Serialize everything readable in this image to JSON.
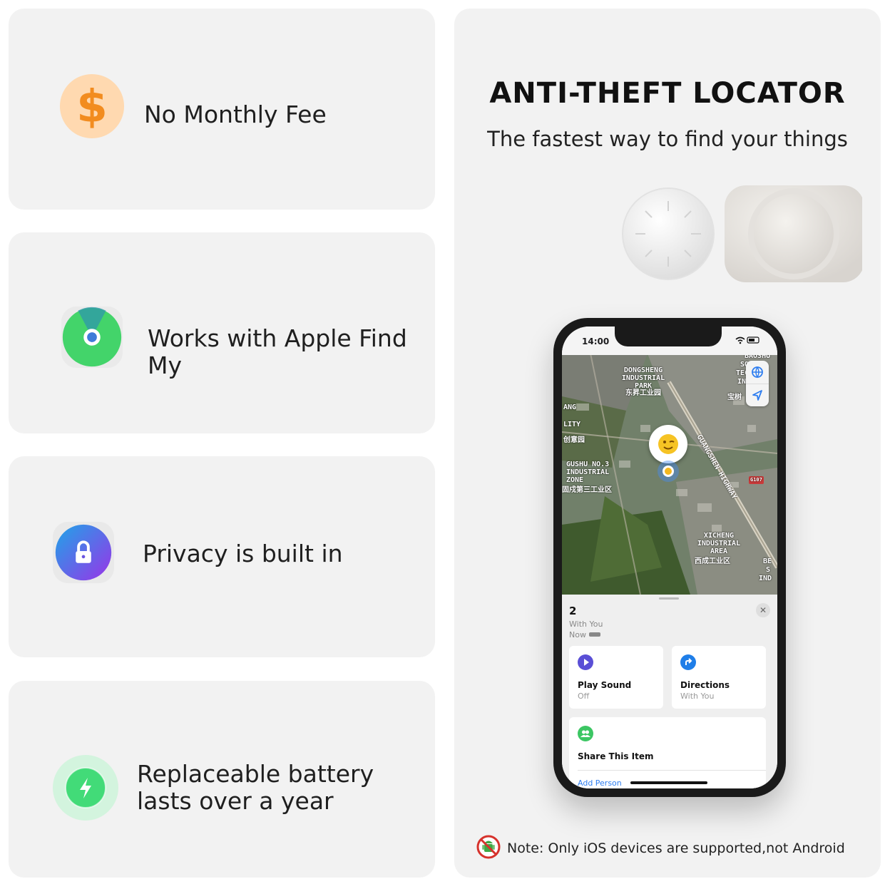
{
  "features": [
    {
      "label": "No Monthly Fee",
      "icon": "dollar-icon"
    },
    {
      "label": "Works with Apple Find My",
      "icon": "find-my-icon"
    },
    {
      "label": "Privacy is built in",
      "icon": "lock-icon"
    },
    {
      "label": "Replaceable battery lasts over a year",
      "icon": "battery-bolt-icon"
    }
  ],
  "panel": {
    "title": "ANTI-THEFT LOCATOR",
    "subtitle": "The fastest way to find your things"
  },
  "phone": {
    "time": "14:00",
    "map_labels": {
      "dongsheng": "DONGSHENG INDUSTRIAL PARK",
      "dongsheng_cn": "东昇工业园",
      "gushu": "GUSHU NO.3 INDUSTRIAL ZONE",
      "gushu_cn": "固戍第三工业区",
      "xicheng": "XICHENG INDUSTRIAL AREA",
      "xicheng_cn": "西成工业区",
      "highway": "GUANGSHEN HIGHWAY",
      "creative": "创意园",
      "ang": "ANG",
      "lity": "LITY",
      "baoshu": "BAOSHU",
      "so": "SO",
      "tec": "TEC",
      "ind": "IND",
      "baoshu_cn": "宝树",
      "road": "G107",
      "be": "BE",
      "s": "S",
      "ind2": "IND"
    },
    "sheet": {
      "count": "2",
      "with_you": "With You",
      "now": "Now",
      "play_sound": "Play Sound",
      "play_sound_sub": "Off",
      "directions": "Directions",
      "directions_sub": "With You",
      "share": "Share This Item",
      "add_person": "Add Person"
    }
  },
  "note": "Note: Only iOS devices are supported,not Android",
  "colors": {
    "card_bg": "#f2f2f2",
    "dollar": "#f79a2e",
    "find_my_green": "#45d66b",
    "lock_gradient": "#2f7df6",
    "battery_green": "#42e07a"
  }
}
